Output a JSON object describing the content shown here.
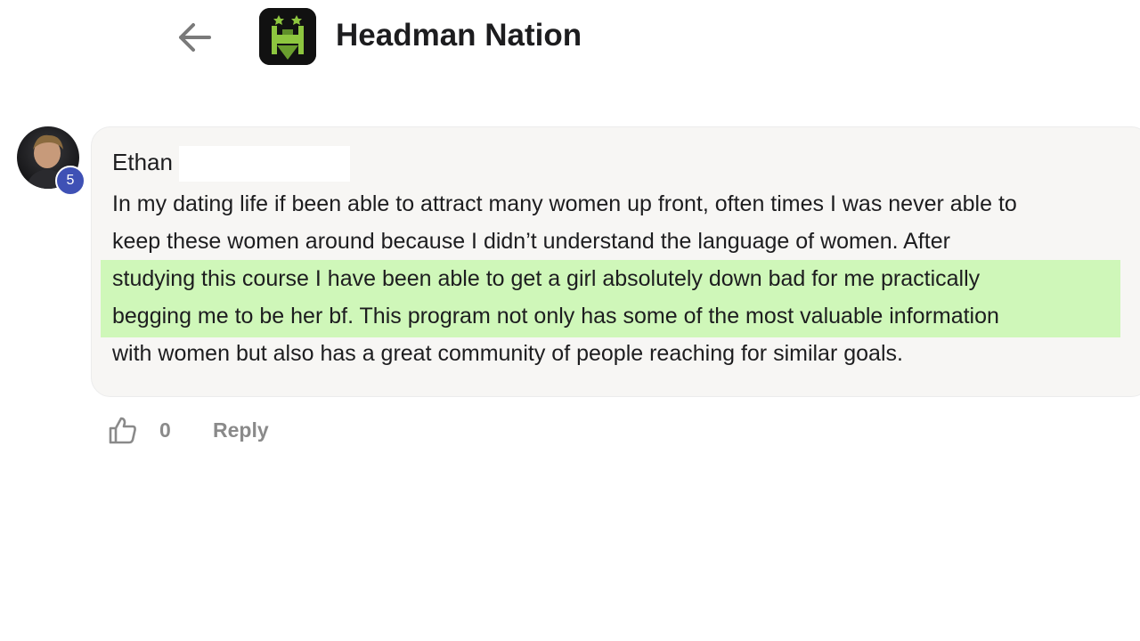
{
  "header": {
    "group_name": "Headman Nation",
    "back_icon": "arrow-left-icon",
    "logo_icon": "headman-crown-logo"
  },
  "comment": {
    "author": "Ethan",
    "level": "5",
    "highlight_color": "#cff7b9",
    "lines": [
      "In my dating life if been able to attract many women up front, often times I was never able to",
      "keep these women around because I didn’t understand the language of women. After",
      "studying this course I have been able to get a girl absolutely down bad for me practically",
      "begging me to be her bf. This program not only has some of the most valuable information",
      "with women but also has a great community of people reaching for similar goals."
    ]
  },
  "actions": {
    "like_icon": "thumbs-up-icon",
    "like_count": "0",
    "reply_label": "Reply"
  },
  "colors": {
    "badge": "#3f51b5",
    "bubble_bg": "#f7f6f4",
    "action_text": "#8a8a8a",
    "logo_green": "#8dc63f"
  }
}
